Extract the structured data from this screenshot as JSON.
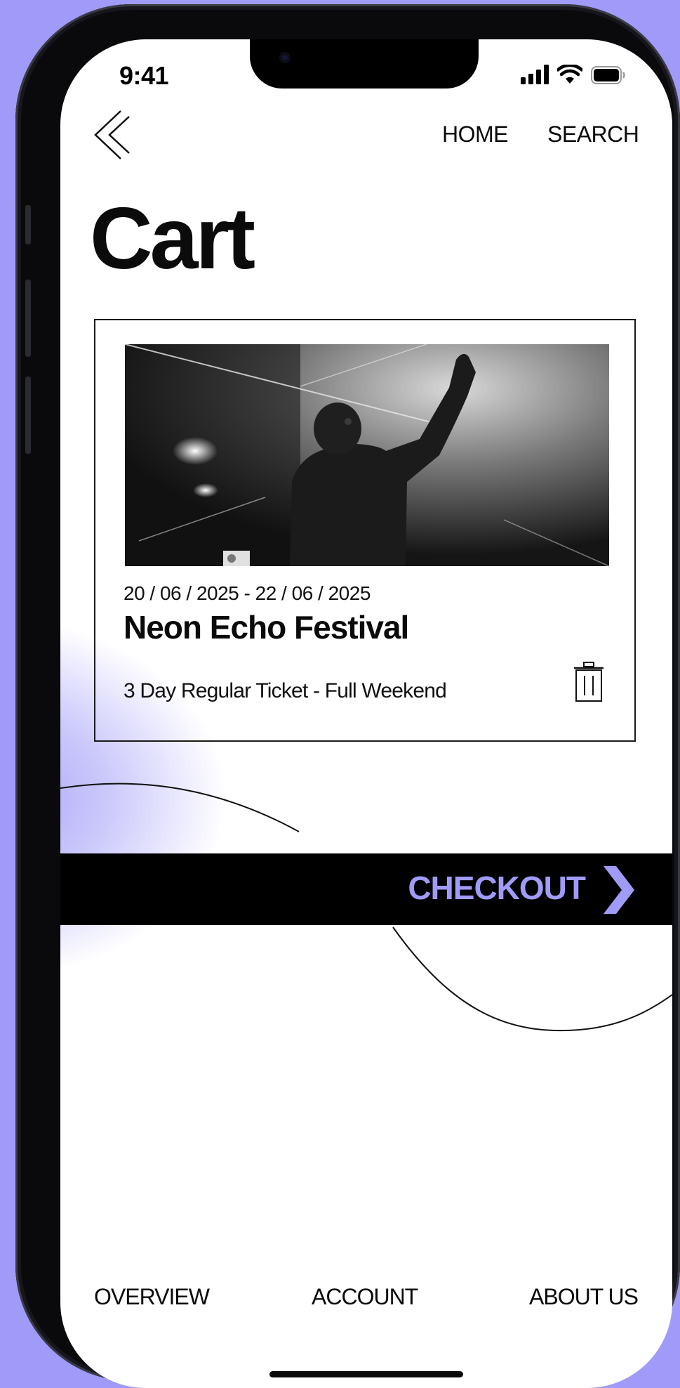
{
  "status_bar": {
    "time": "9:41"
  },
  "nav": {
    "home_label": "HOME",
    "search_label": "SEARCH"
  },
  "page_title": "Cart",
  "cart_item": {
    "dates": "20 / 06 / 2025 - 22 / 06 / 2025",
    "event_name": "Neon Echo Festival",
    "ticket_type": "3 Day Regular Ticket - Full Weekend"
  },
  "checkout": {
    "label": "CHECKOUT"
  },
  "tabs": [
    {
      "label": "OVERVIEW"
    },
    {
      "label": "ACCOUNT"
    },
    {
      "label": "ABOUT US"
    }
  ],
  "icons": {
    "back": "back-chevron-icon",
    "trash": "trash-icon",
    "checkout_arrow": "chevron-right-icon",
    "signal": "signal-icon",
    "wifi": "wifi-icon",
    "battery": "battery-icon"
  },
  "colors": {
    "accent": "#a09bf8",
    "background": "#ffffff",
    "bar": "#000000",
    "text": "#0a0a0a"
  }
}
